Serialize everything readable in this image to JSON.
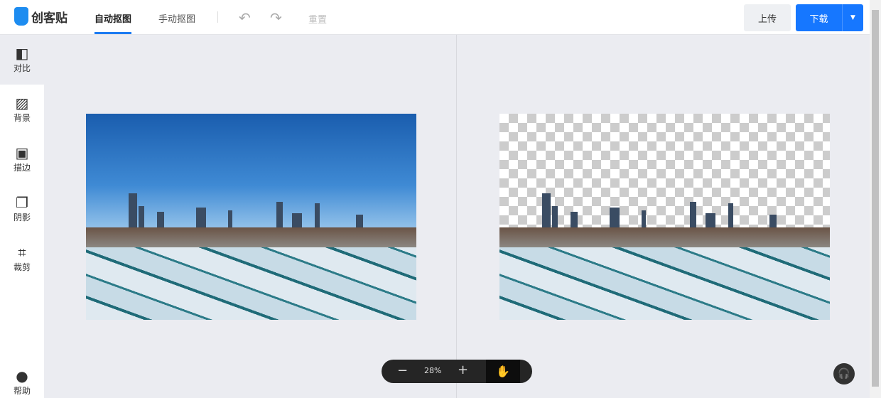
{
  "header": {
    "logo_text": "创客贴",
    "logo_subtitle": "让设计更简单",
    "tabs": [
      {
        "label": "自动抠图",
        "active": true
      },
      {
        "label": "手动抠图",
        "active": false
      }
    ],
    "undo_icon": "undo-icon",
    "redo_icon": "redo-icon",
    "reset_label": "重置",
    "upload_label": "上传",
    "download_label": "下载"
  },
  "sidebar": {
    "items": [
      {
        "label": "对比",
        "icon": "compare-icon"
      },
      {
        "label": "背景",
        "icon": "background-icon"
      },
      {
        "label": "描边",
        "icon": "stroke-icon"
      },
      {
        "label": "阴影",
        "icon": "shadow-icon"
      },
      {
        "label": "裁剪",
        "icon": "crop-icon"
      }
    ],
    "help_label": "帮助"
  },
  "zoom": {
    "value": "28%"
  },
  "colors": {
    "accent": "#1677ff"
  }
}
